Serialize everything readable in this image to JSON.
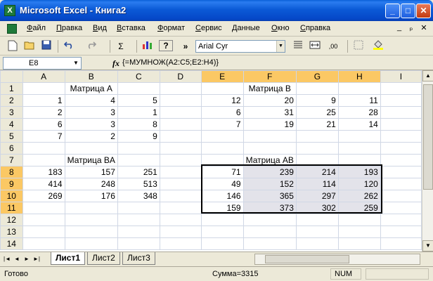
{
  "window": {
    "title": "Microsoft Excel - Книга2",
    "app_icon": "excel-icon",
    "buttons": {
      "minimize": "_",
      "maximize": "□",
      "close": "✕"
    }
  },
  "menu": {
    "items": [
      "Файл",
      "Правка",
      "Вид",
      "Вставка",
      "Формат",
      "Сервис",
      "Данные",
      "Окно",
      "Справка"
    ],
    "mdi": {
      "minimize": "_",
      "restore": "ₚ",
      "close": "✕"
    }
  },
  "toolbar": {
    "font_name": "Arial Cyr",
    "icons": [
      "new-icon",
      "open-icon",
      "save-icon",
      "undo-icon",
      "redo-icon",
      "autosum-icon",
      "chart-icon",
      "help-icon",
      "align-left-icon",
      "merge-center-icon",
      "increase-decimal-icon",
      "borders-icon",
      "fill-color-icon"
    ],
    "sigma": "Σ",
    "more": "»",
    "help": "?"
  },
  "formula_bar": {
    "name_box": "E8",
    "fx": "fx",
    "formula": "{=МУМНОЖ(A2:C5;E2:H4)}"
  },
  "sheet": {
    "columns": [
      "A",
      "B",
      "C",
      "D",
      "E",
      "F",
      "G",
      "H",
      "I"
    ],
    "rows": [
      {
        "n": "1",
        "c": [
          "",
          "Матрица A",
          "",
          "",
          "",
          "Матрица B",
          "",
          "",
          ""
        ]
      },
      {
        "n": "2",
        "c": [
          "1",
          "4",
          "5",
          "",
          "12",
          "20",
          "9",
          "11",
          ""
        ]
      },
      {
        "n": "3",
        "c": [
          "2",
          "3",
          "1",
          "",
          "6",
          "31",
          "25",
          "28",
          ""
        ]
      },
      {
        "n": "4",
        "c": [
          "6",
          "3",
          "8",
          "",
          "7",
          "19",
          "21",
          "14",
          ""
        ]
      },
      {
        "n": "5",
        "c": [
          "7",
          "2",
          "9",
          "",
          "",
          "",
          "",
          "",
          ""
        ]
      },
      {
        "n": "6",
        "c": [
          "",
          "",
          "",
          "",
          "",
          "",
          "",
          "",
          ""
        ]
      },
      {
        "n": "7",
        "c": [
          "",
          "Матрица BA",
          "",
          "",
          "",
          "Матрица AB",
          "",
          "",
          ""
        ]
      },
      {
        "n": "8",
        "c": [
          "183",
          "157",
          "251",
          "",
          "71",
          "239",
          "214",
          "193",
          ""
        ]
      },
      {
        "n": "9",
        "c": [
          "414",
          "248",
          "513",
          "",
          "49",
          "152",
          "114",
          "120",
          ""
        ]
      },
      {
        "n": "10",
        "c": [
          "269",
          "176",
          "348",
          "",
          "146",
          "365",
          "297",
          "262",
          ""
        ]
      },
      {
        "n": "11",
        "c": [
          "",
          "",
          "",
          "",
          "159",
          "373",
          "302",
          "259",
          ""
        ]
      },
      {
        "n": "12",
        "c": [
          "",
          "",
          "",
          "",
          "",
          "",
          "",
          "",
          ""
        ]
      },
      {
        "n": "13",
        "c": [
          "",
          "",
          "",
          "",
          "",
          "",
          "",
          "",
          ""
        ]
      },
      {
        "n": "14",
        "c": [
          "",
          "",
          "",
          "",
          "",
          "",
          "",
          "",
          ""
        ]
      }
    ]
  },
  "tabs": [
    "Лист1",
    "Лист2",
    "Лист3"
  ],
  "status": {
    "ready": "Готово",
    "sum": "Сумма=3315",
    "num": "NUM"
  }
}
